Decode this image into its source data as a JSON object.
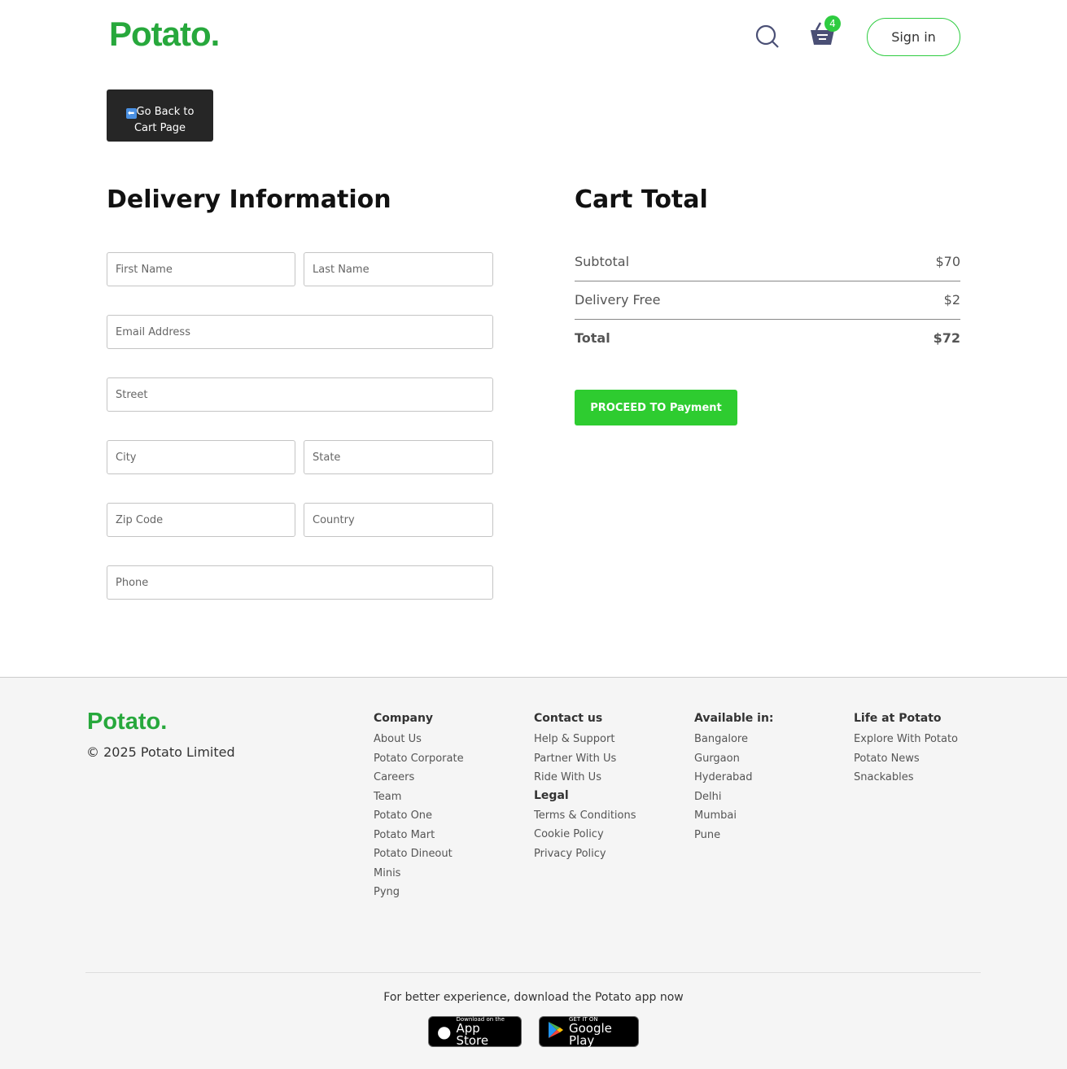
{
  "header": {
    "logo": "Potato.",
    "cart_count": "4",
    "signin": "Sign in"
  },
  "back_button": {
    "icon": "⬅",
    "label_line1": "Go Back to",
    "label_line2": "Cart Page"
  },
  "delivery": {
    "title": "Delivery Information",
    "fields": {
      "first_name": "First Name",
      "last_name": "Last Name",
      "email": "Email Address",
      "street": "Street",
      "city": "City",
      "state": "State",
      "zip": "Zip Code",
      "country": "Country",
      "phone": "Phone"
    }
  },
  "cart": {
    "title": "Cart Total",
    "subtotal_label": "Subtotal",
    "subtotal": "$70",
    "delivery_label": "Delivery Free",
    "delivery": "$2",
    "total_label": "Total",
    "total": "$72",
    "proceed": "PROCEED TO Payment"
  },
  "footer": {
    "logo": "Potato.",
    "copyright": "© 2025 Potato Limited",
    "company": {
      "title": "Company",
      "items": [
        "About Us",
        "Potato Corporate",
        "Careers",
        "Team",
        "Potato One",
        "Potato Mart",
        "Potato Dineout",
        "Minis",
        "Pyng"
      ]
    },
    "contact": {
      "title": "Contact us",
      "items": [
        "Help & Support",
        "Partner With Us",
        "Ride With Us"
      ]
    },
    "legal": {
      "title": "Legal",
      "items": [
        "Terms & Conditions",
        "Cookie Policy",
        "Privacy Policy"
      ]
    },
    "available": {
      "title": "Available in:",
      "items": [
        "Bangalore",
        "Gurgaon",
        "Hyderabad",
        "Delhi",
        "Mumbai",
        "Pune"
      ]
    },
    "life": {
      "title": "Life at Potato",
      "items": [
        "Explore With Potato",
        "Potato News",
        "Snackables"
      ]
    },
    "download_text": "For better experience, download the Potato app now",
    "appstore_small": "Download on the",
    "appstore": "App Store",
    "gplay_small": "GET IT ON",
    "gplay": "Google Play"
  }
}
